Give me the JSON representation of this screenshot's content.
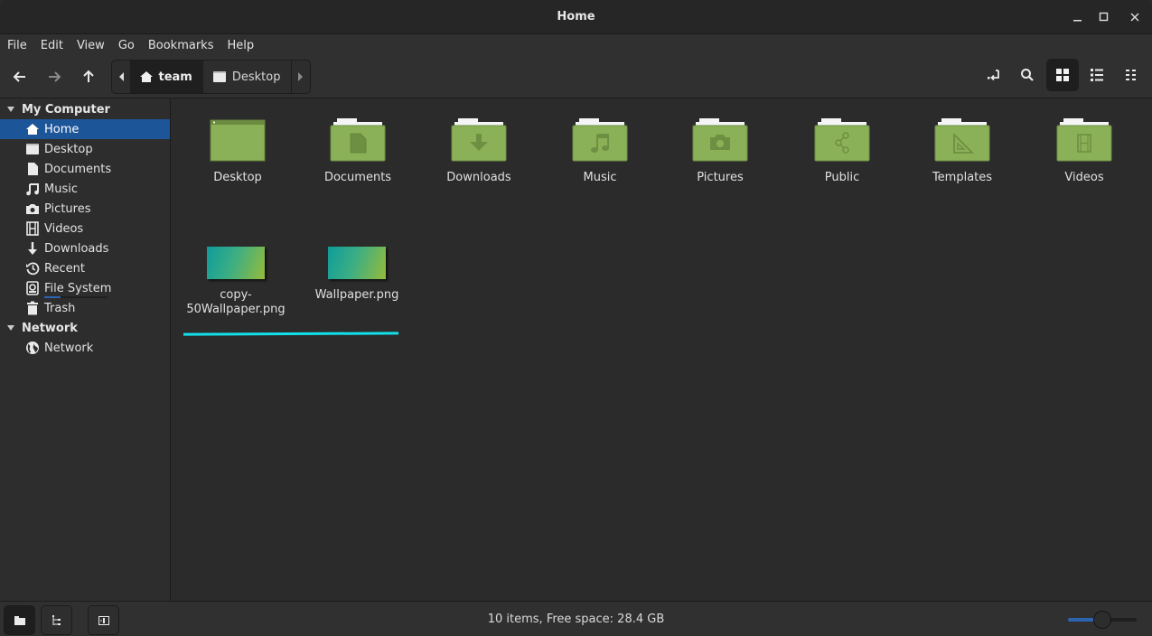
{
  "window": {
    "title": "Home",
    "controls": [
      "minimize",
      "maximize",
      "close"
    ]
  },
  "menubar": {
    "items": [
      "File",
      "Edit",
      "View",
      "Go",
      "Bookmarks",
      "Help"
    ]
  },
  "toolbar": {
    "back_icon": "arrow-left-icon",
    "forward_icon": "arrow-right-icon",
    "up_icon": "arrow-up-icon",
    "breadcrumb": [
      {
        "label": "team",
        "icon": "home-icon",
        "active": true
      },
      {
        "label": "Desktop",
        "icon": "desktop-icon",
        "active": false
      }
    ],
    "right_buttons": [
      {
        "name": "location-toggle",
        "icon": "location-entry-icon",
        "active": false
      },
      {
        "name": "search",
        "icon": "search-icon",
        "active": false
      },
      {
        "name": "icon-view",
        "icon": "grid-icon",
        "active": true
      },
      {
        "name": "list-view",
        "icon": "list-icon",
        "active": false
      },
      {
        "name": "compact-view",
        "icon": "compact-icon",
        "active": false
      }
    ]
  },
  "sidebar": {
    "sections": [
      {
        "title": "My Computer",
        "items": [
          {
            "label": "Home",
            "icon": "home-icon",
            "selected": true
          },
          {
            "label": "Desktop",
            "icon": "desktop-icon"
          },
          {
            "label": "Documents",
            "icon": "document-icon"
          },
          {
            "label": "Music",
            "icon": "music-icon"
          },
          {
            "label": "Pictures",
            "icon": "camera-icon"
          },
          {
            "label": "Videos",
            "icon": "film-icon"
          },
          {
            "label": "Downloads",
            "icon": "download-icon"
          },
          {
            "label": "Recent",
            "icon": "history-icon"
          },
          {
            "label": "File System",
            "icon": "drive-icon",
            "usage": 0.25
          },
          {
            "label": "Trash",
            "icon": "trash-icon"
          }
        ]
      },
      {
        "title": "Network",
        "items": [
          {
            "label": "Network",
            "icon": "globe-icon"
          }
        ]
      }
    ]
  },
  "main": {
    "folders": [
      {
        "label": "Desktop",
        "emblem": "desktop"
      },
      {
        "label": "Documents",
        "emblem": "document"
      },
      {
        "label": "Downloads",
        "emblem": "download"
      },
      {
        "label": "Music",
        "emblem": "music"
      },
      {
        "label": "Pictures",
        "emblem": "camera"
      },
      {
        "label": "Public",
        "emblem": "share"
      },
      {
        "label": "Templates",
        "emblem": "triangle-ruler"
      },
      {
        "label": "Videos",
        "emblem": "film"
      }
    ],
    "files": [
      {
        "label": "copy-\n50Wallpaper.png",
        "label_line1": "copy-",
        "label_line2": "50Wallpaper.png"
      },
      {
        "label": "Wallpaper.png",
        "label_line1": "Wallpaper.png",
        "label_line2": ""
      }
    ]
  },
  "statusbar": {
    "text": "10 items, Free space: 28.4 GB",
    "left_buttons": [
      {
        "name": "places",
        "icon": "folder-icon",
        "active": true
      },
      {
        "name": "tree",
        "icon": "tree-icon",
        "active": false
      },
      {
        "name": "toggle-sidebar",
        "icon": "sidebar-icon",
        "active": false
      }
    ],
    "zoom_level": 0.5
  },
  "colors": {
    "accent": "#1d5599",
    "folder_green": "#8bb158",
    "folder_emblem": "#6d8f42",
    "highlight_line": "#12e0ea"
  }
}
